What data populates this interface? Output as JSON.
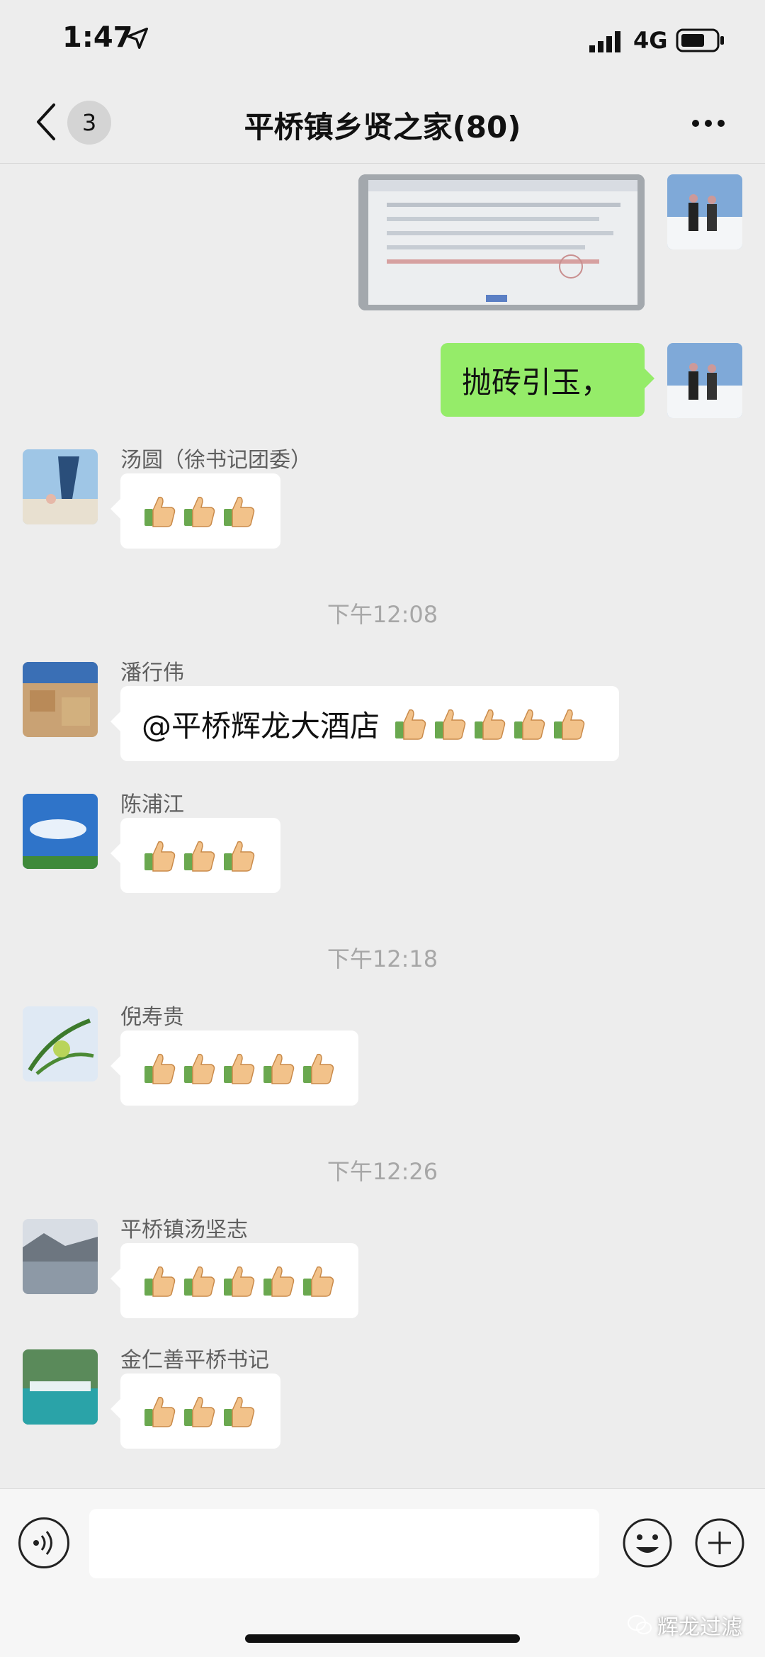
{
  "status_bar": {
    "time": "1:47",
    "network": "4G"
  },
  "header": {
    "unread_count": "3",
    "title": "平桥镇乡贤之家(80)"
  },
  "messages": [
    {
      "type": "image",
      "side": "right",
      "sender": "me"
    },
    {
      "type": "text",
      "side": "right",
      "sender": "me",
      "text": "抛砖引玉，"
    },
    {
      "type": "emoji",
      "side": "left",
      "sender": "汤圆（徐书记团委）",
      "thumbs": 3
    },
    {
      "type": "time",
      "text": "下午12:08"
    },
    {
      "type": "mixed",
      "side": "left",
      "sender": "潘行伟",
      "text": "@平桥辉龙大酒店",
      "thumbs": 5
    },
    {
      "type": "emoji",
      "side": "left",
      "sender": "陈浦江",
      "thumbs": 3
    },
    {
      "type": "time",
      "text": "下午12:18"
    },
    {
      "type": "emoji",
      "side": "left",
      "sender": "倪寿贵",
      "thumbs": 5
    },
    {
      "type": "time",
      "text": "下午12:26"
    },
    {
      "type": "emoji",
      "side": "left",
      "sender": "平桥镇汤坚志",
      "thumbs": 5
    },
    {
      "type": "emoji",
      "side": "left",
      "sender": "金仁善平桥书记",
      "thumbs": 3
    }
  ],
  "input_bar": {
    "placeholder": ""
  },
  "watermark": "辉龙过滤",
  "colors": {
    "background": "#ededed",
    "self_bubble": "#95ec69",
    "other_bubble": "#ffffff",
    "timestamp": "#a7a7a7"
  }
}
